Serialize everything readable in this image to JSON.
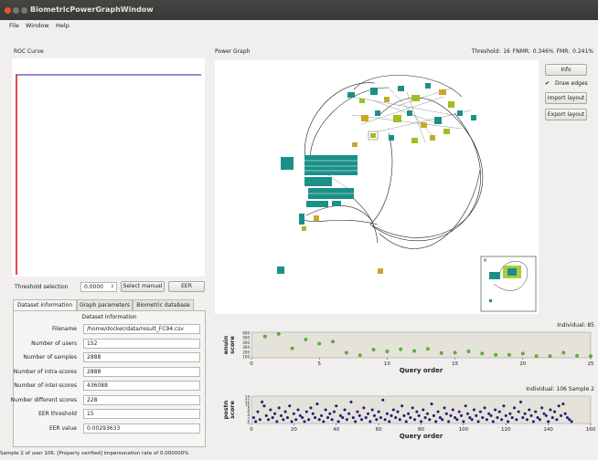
{
  "window": {
    "title": "BiometricPowerGraphWindow"
  },
  "menu": [
    "File",
    "Window",
    "Help"
  ],
  "roc": {
    "label": "ROC Curve"
  },
  "threshold": {
    "label": "Threshold selection",
    "value": "0.0000",
    "select_manual": "Select manual",
    "eer": "EER"
  },
  "tabs": [
    "Dataset information",
    "Graph parameters",
    "Biometric database"
  ],
  "dataset": {
    "group_title": "Dataset Information",
    "rows": [
      {
        "label": "Filename",
        "value": "/home/docker/data/result_FC94.csv"
      },
      {
        "label": "Number of users",
        "value": "152"
      },
      {
        "label": "Number of samples",
        "value": "2888"
      },
      {
        "label": "Number of intra-scores",
        "value": "2888"
      },
      {
        "label": "Number of inter-scores",
        "value": "436088"
      },
      {
        "label": "Number different scores",
        "value": "228"
      },
      {
        "label": "EER threshold",
        "value": "15"
      },
      {
        "label": "EER value",
        "value": "0.00293633"
      }
    ]
  },
  "graph": {
    "label": "Power Graph",
    "stats": "Threshold: 16  FNMR:  0.346%  FMR:  0.241%",
    "buttons": {
      "info": "Info",
      "draw_edges": "Draw edges",
      "import_layout": "Import layout",
      "export_layout": "Export layout"
    },
    "draw_edges_checked": true
  },
  "status": {
    "text": "Sample 2 of user 106. [Properly verified] impersonation rate of 0.000000%"
  },
  "charts": {
    "individual": {
      "header": "Individual:  85",
      "ylabel": "enuin\nscore",
      "xlabel": "Query order",
      "yticks": [
        "100",
        "200",
        "300",
        "400",
        "500",
        "600"
      ],
      "xticks": [
        "0",
        "5",
        "10",
        "15",
        "20",
        "25"
      ],
      "color": "#55cc22"
    },
    "impostor": {
      "header": "Individual:  106  Sample  2",
      "ylabel": "postn\nscore",
      "xlabel": "Query order",
      "yticks": [
        "0",
        "2",
        "4",
        "6",
        "8",
        "10",
        "12",
        "14"
      ],
      "xticks": [
        "0",
        "20",
        "40",
        "60",
        "80",
        "100",
        "120",
        "140",
        "160"
      ],
      "color": "#1a1aa0"
    }
  },
  "chart_data": [
    {
      "type": "scatter",
      "x": [
        1,
        2,
        3,
        4,
        5,
        6,
        7,
        8,
        9,
        10,
        11,
        12,
        13,
        14,
        15,
        16,
        17,
        18,
        19,
        20,
        21,
        22,
        23,
        24,
        25
      ],
      "y": [
        250,
        280,
        110,
        215,
        165,
        190,
        60,
        30,
        95,
        75,
        100,
        80,
        105,
        55,
        60,
        75,
        50,
        35,
        35,
        50,
        20,
        20,
        60,
        25,
        20
      ],
      "xlabel": "Query order",
      "ylabel": "enuin score",
      "xlim": [
        0,
        25
      ],
      "ylim": [
        0,
        300
      ]
    },
    {
      "type": "scatter",
      "x": [
        1,
        2,
        3,
        4,
        5,
        6,
        7,
        8,
        9,
        10,
        11,
        12,
        13,
        14,
        15,
        16,
        17,
        18,
        19,
        20,
        21,
        22,
        23,
        24,
        25,
        26,
        27,
        28,
        29,
        30,
        31,
        32,
        33,
        34,
        35,
        36,
        37,
        38,
        39,
        40,
        41,
        42,
        43,
        44,
        45,
        46,
        47,
        48,
        49,
        50,
        51,
        52,
        53,
        54,
        55,
        56,
        57,
        58,
        59,
        60,
        61,
        62,
        63,
        64,
        65,
        66,
        67,
        68,
        69,
        70,
        71,
        72,
        73,
        74,
        75,
        76,
        77,
        78,
        79,
        80,
        81,
        82,
        83,
        84,
        85,
        86,
        87,
        88,
        89,
        90,
        91,
        92,
        93,
        94,
        95,
        96,
        97,
        98,
        99,
        100,
        101,
        102,
        103,
        104,
        105,
        106,
        107,
        108,
        109,
        110,
        111,
        112,
        113,
        114,
        115,
        116,
        117,
        118,
        119,
        120,
        121,
        122,
        123,
        124,
        125,
        126,
        127,
        128,
        129,
        130,
        131,
        132,
        133,
        134,
        135,
        136,
        137,
        138,
        139,
        140,
        141,
        142,
        143,
        144,
        145,
        146,
        147,
        148,
        149,
        150,
        151
      ],
      "y": [
        3,
        1,
        6,
        2,
        11,
        9,
        4,
        2,
        7,
        3,
        5,
        1,
        8,
        4,
        2,
        6,
        3,
        9,
        1,
        5,
        2,
        7,
        4,
        3,
        1,
        6,
        2,
        8,
        5,
        3,
        10,
        2,
        4,
        1,
        7,
        3,
        5,
        2,
        6,
        9,
        1,
        4,
        3,
        7,
        2,
        5,
        11,
        3,
        1,
        6,
        4,
        2,
        8,
        3,
        5,
        1,
        7,
        4,
        2,
        6,
        3,
        12,
        2,
        5,
        1,
        4,
        7,
        3,
        6,
        2,
        9,
        4,
        1,
        5,
        3,
        8,
        2,
        6,
        4,
        1,
        7,
        3,
        5,
        2,
        10,
        4,
        1,
        6,
        3,
        2,
        8,
        5,
        1,
        4,
        7,
        3,
        2,
        6,
        4,
        1,
        9,
        5,
        3,
        2,
        7,
        4,
        1,
        6,
        3,
        8,
        2,
        5,
        4,
        1,
        7,
        3,
        6,
        2,
        9,
        4,
        1,
        5,
        3,
        8,
        2,
        6,
        11,
        3,
        5,
        2,
        7,
        4,
        1,
        6,
        3,
        2,
        8,
        5,
        4,
        1,
        7,
        3,
        6,
        2,
        9,
        4,
        10,
        5,
        3,
        2,
        1
      ],
      "xlabel": "Query order",
      "ylabel": "postn score",
      "xlim": [
        0,
        160
      ],
      "ylim": [
        0,
        14
      ]
    }
  ]
}
